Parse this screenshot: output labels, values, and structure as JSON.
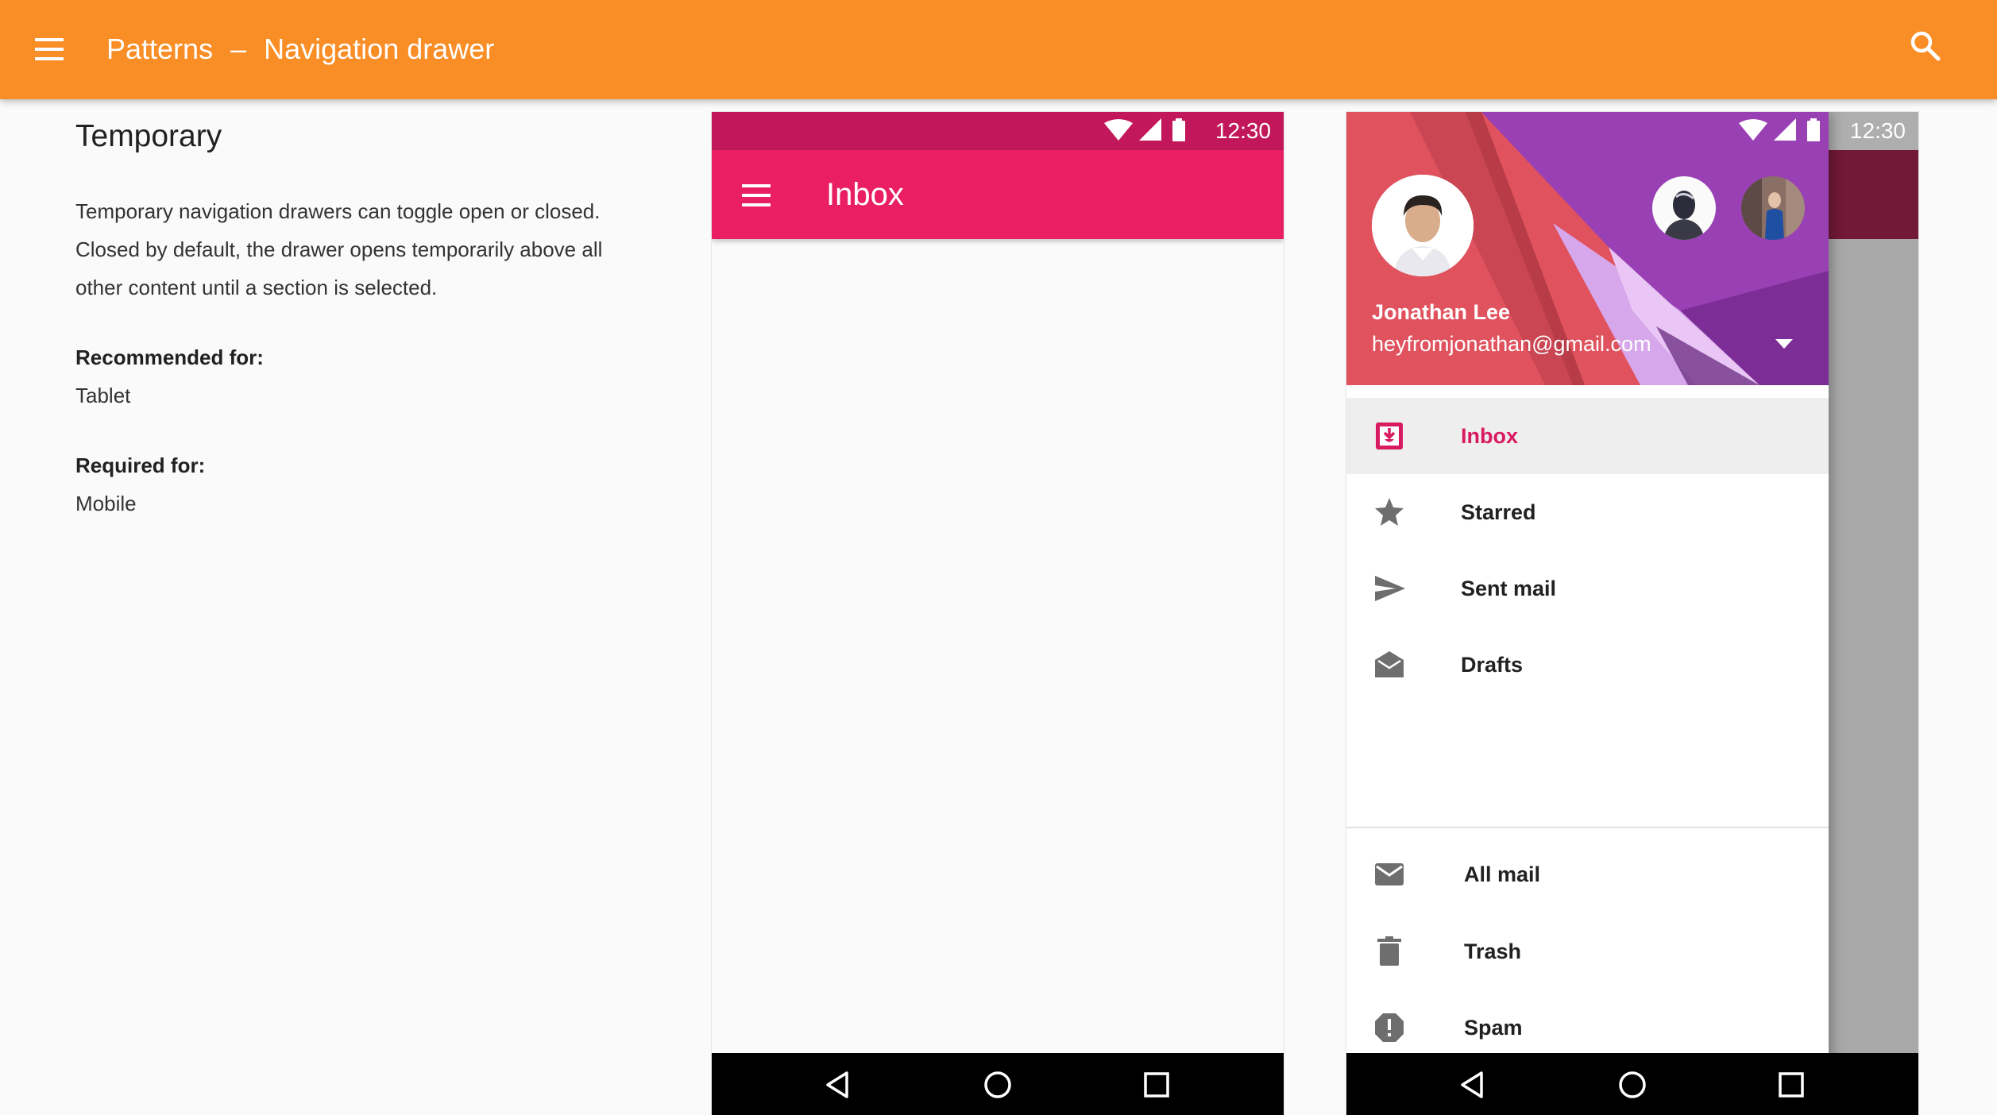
{
  "appbar": {
    "title": "Patterns",
    "separator": "–",
    "subtitle": "Navigation drawer",
    "menu_icon": "menu-icon",
    "search_icon": "search-icon",
    "color": "#f98d26"
  },
  "description": {
    "heading": "Temporary",
    "body": "Temporary navigation drawers can toggle open or closed. Closed by default, the drawer opens temporarily above all other content until a section is selected.",
    "recommended_label": "Recommended for:",
    "recommended_value": "Tablet",
    "required_label": "Required for:",
    "required_value": "Mobile"
  },
  "phone_closed": {
    "time": "12:30",
    "toolbar_title": "Inbox",
    "accent": "#e91e63"
  },
  "phone_open": {
    "time": "12:30",
    "account": {
      "name": "Jonathan Lee",
      "email": "heyfromjonathan@gmail.com"
    },
    "items": [
      {
        "label": "Inbox",
        "icon": "inbox-icon",
        "selected": true
      },
      {
        "label": "Starred",
        "icon": "star-icon"
      },
      {
        "label": "Sent mail",
        "icon": "send-icon"
      },
      {
        "label": "Drafts",
        "icon": "drafts-icon"
      },
      {
        "label": "All mail",
        "icon": "mail-icon"
      },
      {
        "label": "Trash",
        "icon": "trash-icon"
      },
      {
        "label": "Spam",
        "icon": "spam-icon"
      }
    ]
  },
  "navbar": {
    "icons": [
      "back-icon",
      "home-icon",
      "recents-icon"
    ]
  }
}
